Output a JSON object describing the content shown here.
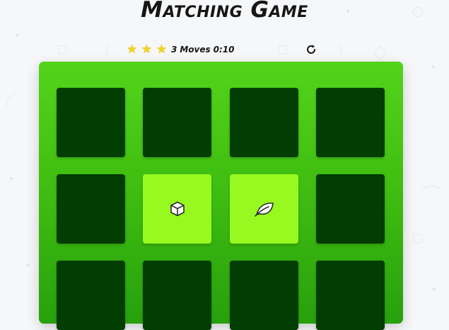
{
  "game": {
    "title": "Matching Game"
  },
  "score_panel": {
    "stars": [
      {
        "icon": "star-icon",
        "symbol": "★",
        "filled": true
      },
      {
        "icon": "star-icon",
        "symbol": "★",
        "filled": true
      },
      {
        "icon": "star-icon",
        "symbol": "★",
        "filled": true
      }
    ],
    "moves_count": "3",
    "moves_label": "Moves",
    "timer": "0:10",
    "restart_icon": "refresh-icon"
  },
  "deck": {
    "columns": 4,
    "rows_visible": 3,
    "cards": [
      {
        "state": "closed",
        "icon": null
      },
      {
        "state": "closed",
        "icon": null
      },
      {
        "state": "closed",
        "icon": null
      },
      {
        "state": "closed",
        "icon": null
      },
      {
        "state": "closed",
        "icon": null
      },
      {
        "state": "open",
        "icon": "cube-icon"
      },
      {
        "state": "open",
        "icon": "leaf-icon"
      },
      {
        "state": "closed",
        "icon": null
      },
      {
        "state": "closed",
        "icon": null
      },
      {
        "state": "closed",
        "icon": null
      },
      {
        "state": "closed",
        "icon": null
      },
      {
        "state": "closed",
        "icon": null
      }
    ]
  },
  "colors": {
    "page_background": "#f6f7f9",
    "board_green": "#43c014",
    "card_closed": "#023d02",
    "card_open": "#97f91f",
    "star": "#f3d31c",
    "text": "#161616"
  }
}
